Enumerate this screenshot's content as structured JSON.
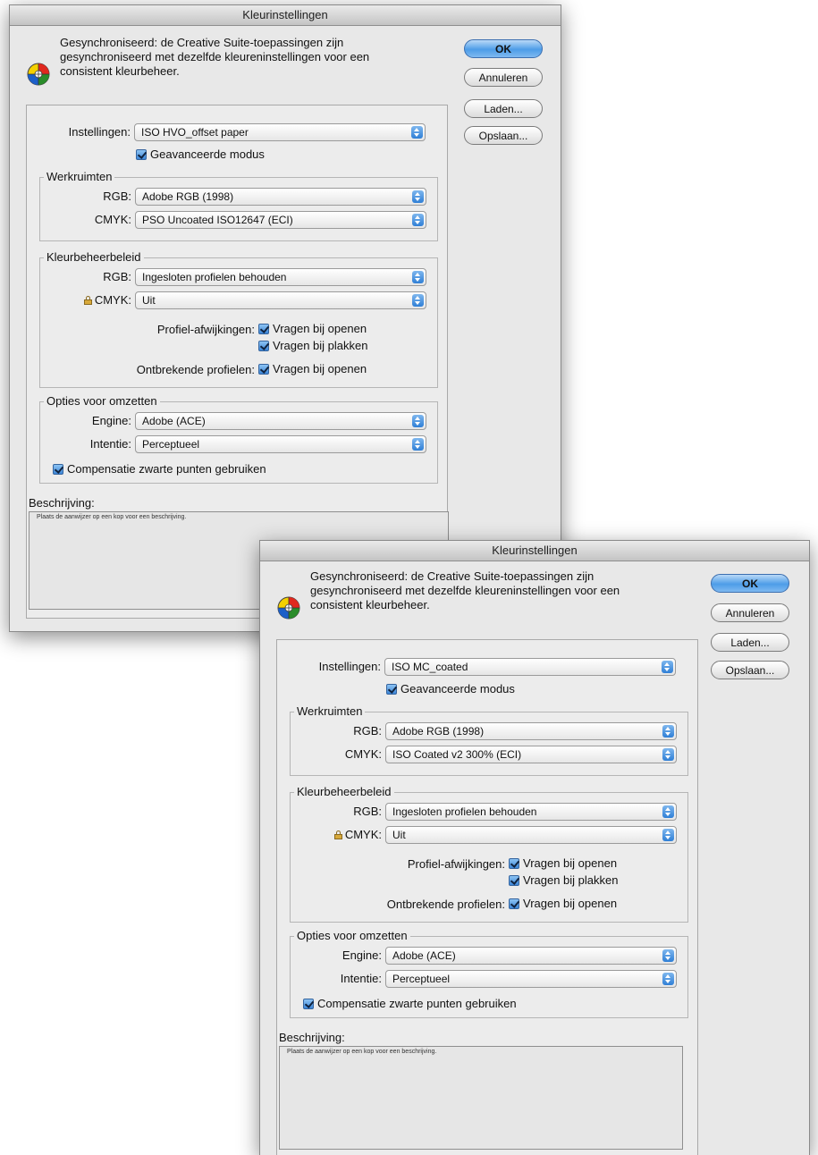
{
  "colors": {
    "window_bg": "#e8e8e8",
    "default_button": "#4d9de8",
    "checkbox_blue": "#3c86d8"
  },
  "dialog_back": {
    "title": "Kleurinstellingen",
    "header": "Gesynchroniseerd: de Creative Suite-toepassingen zijn gesynchroniseerd met dezelfde kleureninstellingen voor een consistent kleurbeheer.",
    "buttons": {
      "ok": "OK",
      "cancel": "Annuleren",
      "load": "Laden...",
      "save": "Opslaan..."
    },
    "settings": {
      "label": "Instellingen:",
      "value": "ISO HVO_offset paper",
      "advanced_mode": "Geavanceerde modus",
      "advanced_checked": true
    },
    "workspaces": {
      "legend": "Werkruimten",
      "rgb_label": "RGB:",
      "rgb_value": "Adobe RGB (1998)",
      "cmyk_label": "CMYK:",
      "cmyk_value": "PSO Uncoated ISO12647 (ECI)"
    },
    "policies": {
      "legend": "Kleurbeheerbeleid",
      "rgb_label": "RGB:",
      "rgb_value": "Ingesloten profielen behouden",
      "cmyk_label": "CMYK:",
      "cmyk_value": "Uit",
      "mismatch_label": "Profiel-afwijkingen:",
      "ask_open": "Vragen bij openen",
      "ask_paste": "Vragen bij plakken",
      "missing_label": "Ontbrekende profielen:",
      "missing_ask_open": "Vragen bij openen"
    },
    "conversion": {
      "legend": "Opties voor omzetten",
      "engine_label": "Engine:",
      "engine_value": "Adobe (ACE)",
      "intent_label": "Intentie:",
      "intent_value": "Perceptueel",
      "bpc": "Compensatie zwarte punten gebruiken"
    },
    "description": {
      "label": "Beschrijving:",
      "text": "Plaats de aanwijzer op een kop voor een beschrijving."
    }
  },
  "dialog_front": {
    "title": "Kleurinstellingen",
    "header": "Gesynchroniseerd: de Creative Suite-toepassingen zijn gesynchroniseerd met dezelfde kleureninstellingen voor een consistent kleurbeheer.",
    "buttons": {
      "ok": "OK",
      "cancel": "Annuleren",
      "load": "Laden...",
      "save": "Opslaan..."
    },
    "settings": {
      "label": "Instellingen:",
      "value": "ISO MC_coated",
      "advanced_mode": "Geavanceerde modus",
      "advanced_checked": true
    },
    "workspaces": {
      "legend": "Werkruimten",
      "rgb_label": "RGB:",
      "rgb_value": "Adobe RGB (1998)",
      "cmyk_label": "CMYK:",
      "cmyk_value": "ISO Coated v2 300% (ECI)"
    },
    "policies": {
      "legend": "Kleurbeheerbeleid",
      "rgb_label": "RGB:",
      "rgb_value": "Ingesloten profielen behouden",
      "cmyk_label": "CMYK:",
      "cmyk_value": "Uit",
      "mismatch_label": "Profiel-afwijkingen:",
      "ask_open": "Vragen bij openen",
      "ask_paste": "Vragen bij plakken",
      "missing_label": "Ontbrekende profielen:",
      "missing_ask_open": "Vragen bij openen"
    },
    "conversion": {
      "legend": "Opties voor omzetten",
      "engine_label": "Engine:",
      "engine_value": "Adobe (ACE)",
      "intent_label": "Intentie:",
      "intent_value": "Perceptueel",
      "bpc": "Compensatie zwarte punten gebruiken"
    },
    "description": {
      "label": "Beschrijving:",
      "text": "Plaats de aanwijzer op een kop voor een beschrijving."
    }
  }
}
